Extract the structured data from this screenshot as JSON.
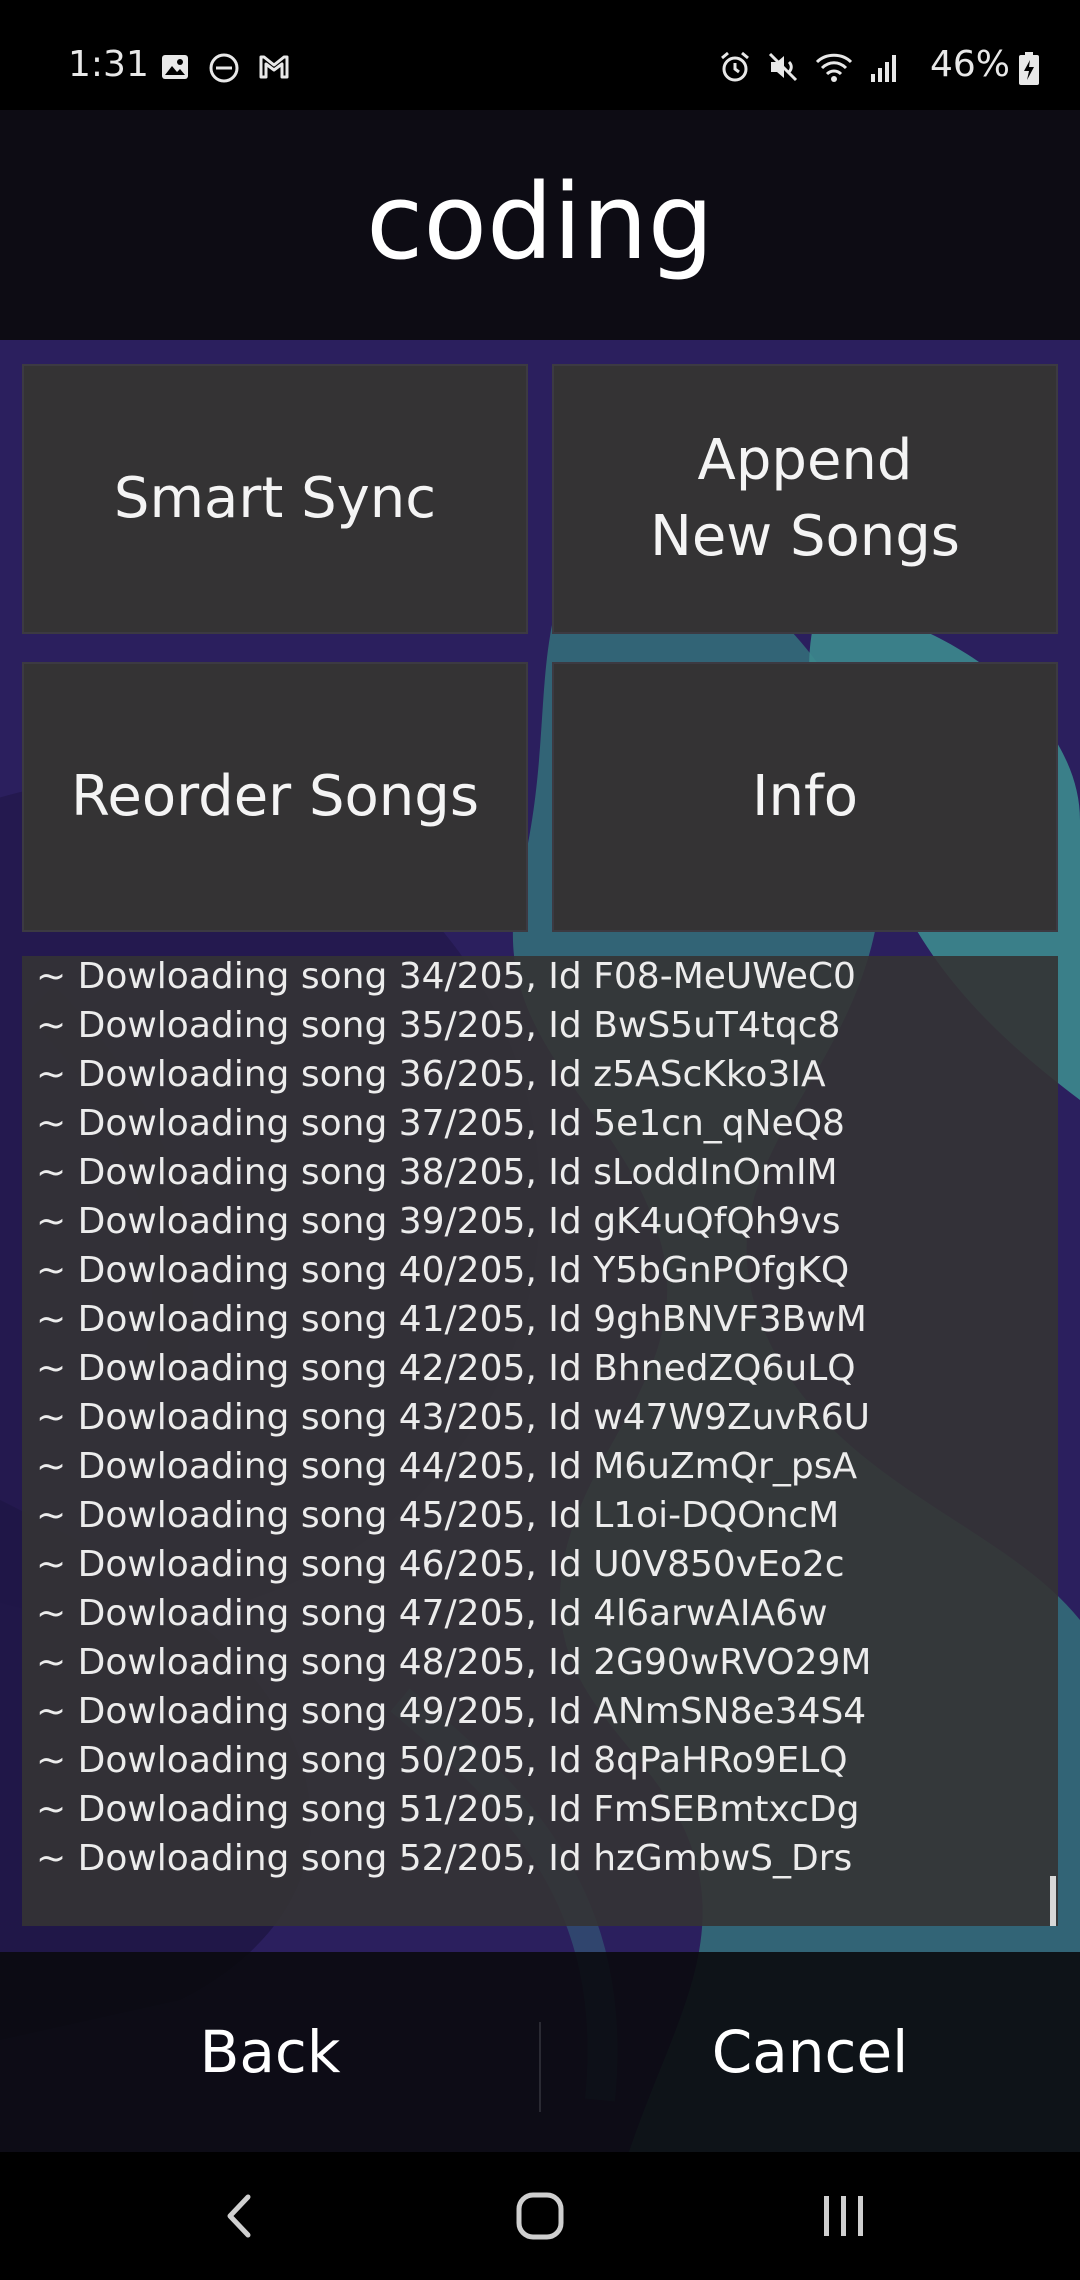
{
  "status_bar": {
    "time": "1:31",
    "battery": "46%",
    "left_icons": [
      "image-icon",
      "do-not-disturb-icon",
      "gmail-icon"
    ],
    "right_icons": [
      "alarm-icon",
      "mute-icon",
      "wifi-icon",
      "signal-icon",
      "battery-charging-icon"
    ]
  },
  "header": {
    "title": "coding"
  },
  "actions": {
    "smart_sync": "Smart Sync",
    "append_new_songs": "Append\nNew Songs",
    "reorder_songs": "Reorder Songs",
    "info": "Info"
  },
  "log": {
    "lines": [
      "~ Dowloading song 34/205, Id F08-MeUWeC0",
      "~ Dowloading song 35/205, Id BwS5uT4tqc8",
      "~ Dowloading song 36/205, Id z5AScKko3IA",
      "~ Dowloading song 37/205, Id 5e1cn_qNeQ8",
      "~ Dowloading song 38/205, Id sLoddInOmIM",
      "~ Dowloading song 39/205, Id gK4uQfQh9vs",
      "~ Dowloading song 40/205, Id Y5bGnPOfgKQ",
      "~ Dowloading song 41/205, Id 9ghBNVF3BwM",
      "~ Dowloading song 42/205, Id BhnedZQ6uLQ",
      "~ Dowloading song 43/205, Id w47W9ZuvR6U",
      "~ Dowloading song 44/205, Id M6uZmQr_psA",
      "~ Dowloading song 45/205, Id L1oi-DQOncM",
      "~ Dowloading song 46/205, Id U0V850vEo2c",
      "~ Dowloading song 47/205, Id 4l6arwAIA6w",
      "~ Dowloading song 48/205, Id 2G90wRVO29M",
      "~ Dowloading song 49/205, Id ANmSN8e34S4",
      "~ Dowloading song 50/205, Id 8qPaHRo9ELQ",
      "~ Dowloading song 51/205, Id FmSEBmtxcDg",
      "~ Dowloading song 52/205, Id hzGmbwS_Drs"
    ]
  },
  "footer": {
    "back": "Back",
    "cancel": "Cancel"
  },
  "nav_bar": {
    "buttons": [
      "nav-back-icon",
      "home-icon",
      "recents-icon"
    ]
  },
  "colors": {
    "background": "#2a1f5c",
    "accent_teal": "#3a7f86",
    "button": "#343334",
    "header": "#0d0c14"
  }
}
